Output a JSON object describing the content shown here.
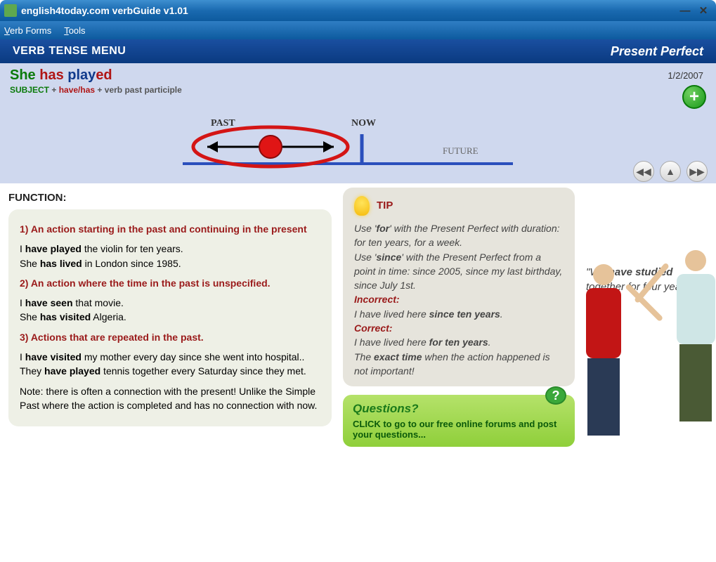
{
  "window": {
    "title": "english4today.com verbGuide v1.01"
  },
  "menubar": {
    "verb_forms": "Verb Forms",
    "tools": "Tools"
  },
  "header": {
    "left": "VERB TENSE MENU",
    "right": "Present Perfect"
  },
  "example": {
    "she": "She",
    "has": "has",
    "play": "play",
    "ed": "ed",
    "formula_subject": "SUBJECT",
    "formula_plus1": " + ",
    "formula_havehas": "have/has",
    "formula_plus2": "  + ",
    "formula_verb": "verb past participle",
    "date": "1/2/2007"
  },
  "timeline": {
    "past": "PAST",
    "now": "NOW",
    "future": "FUTURE"
  },
  "function": {
    "heading": "FUNCTION:",
    "h1": "1) An action starting in the past and continuing in the present",
    "p1a_pre": "I ",
    "p1a_b": "have played",
    "p1a_post": " the violin for ten years.",
    "p1b_pre": "She ",
    "p1b_b": "has lived",
    "p1b_post": " in London since 1985.",
    "h2": "2) An action where the time in the past is unspecified.",
    "p2a_pre": "I ",
    "p2a_b": "have seen",
    "p2a_post": " that movie.",
    "p2b_pre": "She ",
    "p2b_b": "has visited",
    "p2b_post": " Algeria.",
    "h3": "3) Actions that are repeated in the past.",
    "p3a_pre": "I ",
    "p3a_b": "have visited",
    "p3a_post": " my mother every day since she went into hospital..",
    "p3b_pre": "They ",
    "p3b_b": "have played",
    "p3b_post": " tennis together every Saturday since they met.",
    "note": "Note: there is often a connection with the present! Unlike the Simple Past where the action is completed and has no connection with now."
  },
  "tip": {
    "title": "TIP",
    "p1_pre": "Use '",
    "p1_b": "for",
    "p1_post": "' with the Present Perfect with duration: for ten years, for a week.",
    "p2_pre": "Use '",
    "p2_b": "since",
    "p2_post": "' with the Present Perfect from a point in time: since 2005, since my last birthday, since July 1st.",
    "incorrect_label": "Incorrect:",
    "incorrect_pre": "I have lived here ",
    "incorrect_b": "since ten years",
    "incorrect_post": ".",
    "correct_label": "Correct:",
    "correct_pre": "I have lived here ",
    "correct_b": "for ten years",
    "correct_post": ".",
    "p3_pre": "The ",
    "p3_b": "exact time",
    "p3_post": " when the action happened is not important!"
  },
  "questions": {
    "title": "Questions?",
    "body": "CLICK to go to our free online forums and post your questions..."
  },
  "quote": {
    "pre": "\"We ",
    "b": "have studied",
    "post": " together for four years!\""
  }
}
